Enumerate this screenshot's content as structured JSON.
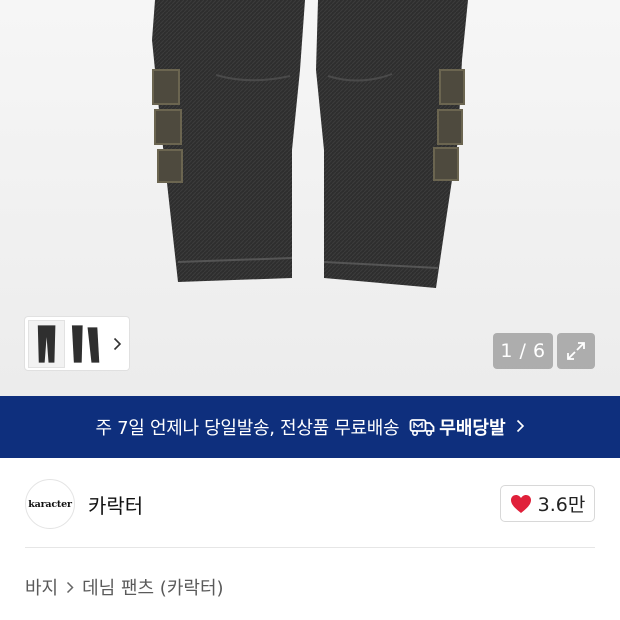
{
  "gallery": {
    "counter": "1 / 6",
    "thumbnails": [
      "jeans-front",
      "jeans-back"
    ],
    "chevron_icon": "chevron-right-icon",
    "expand_icon": "expand-icon"
  },
  "banner": {
    "text": "주 7일 언제나 당일발송, 전상품 무료배송",
    "badge": "무배당발",
    "badge_icon": "delivery-truck-icon",
    "chevron_icon": "chevron-right-icon",
    "background": "#0e2f7d"
  },
  "brand": {
    "logo_text": "karacter",
    "name": "카락터",
    "likes": "3.6만",
    "heart_icon": "heart-icon",
    "heart_color": "#e0203a"
  },
  "breadcrumb": {
    "items": [
      "바지",
      "데님 팬츠 (카락터)"
    ]
  }
}
